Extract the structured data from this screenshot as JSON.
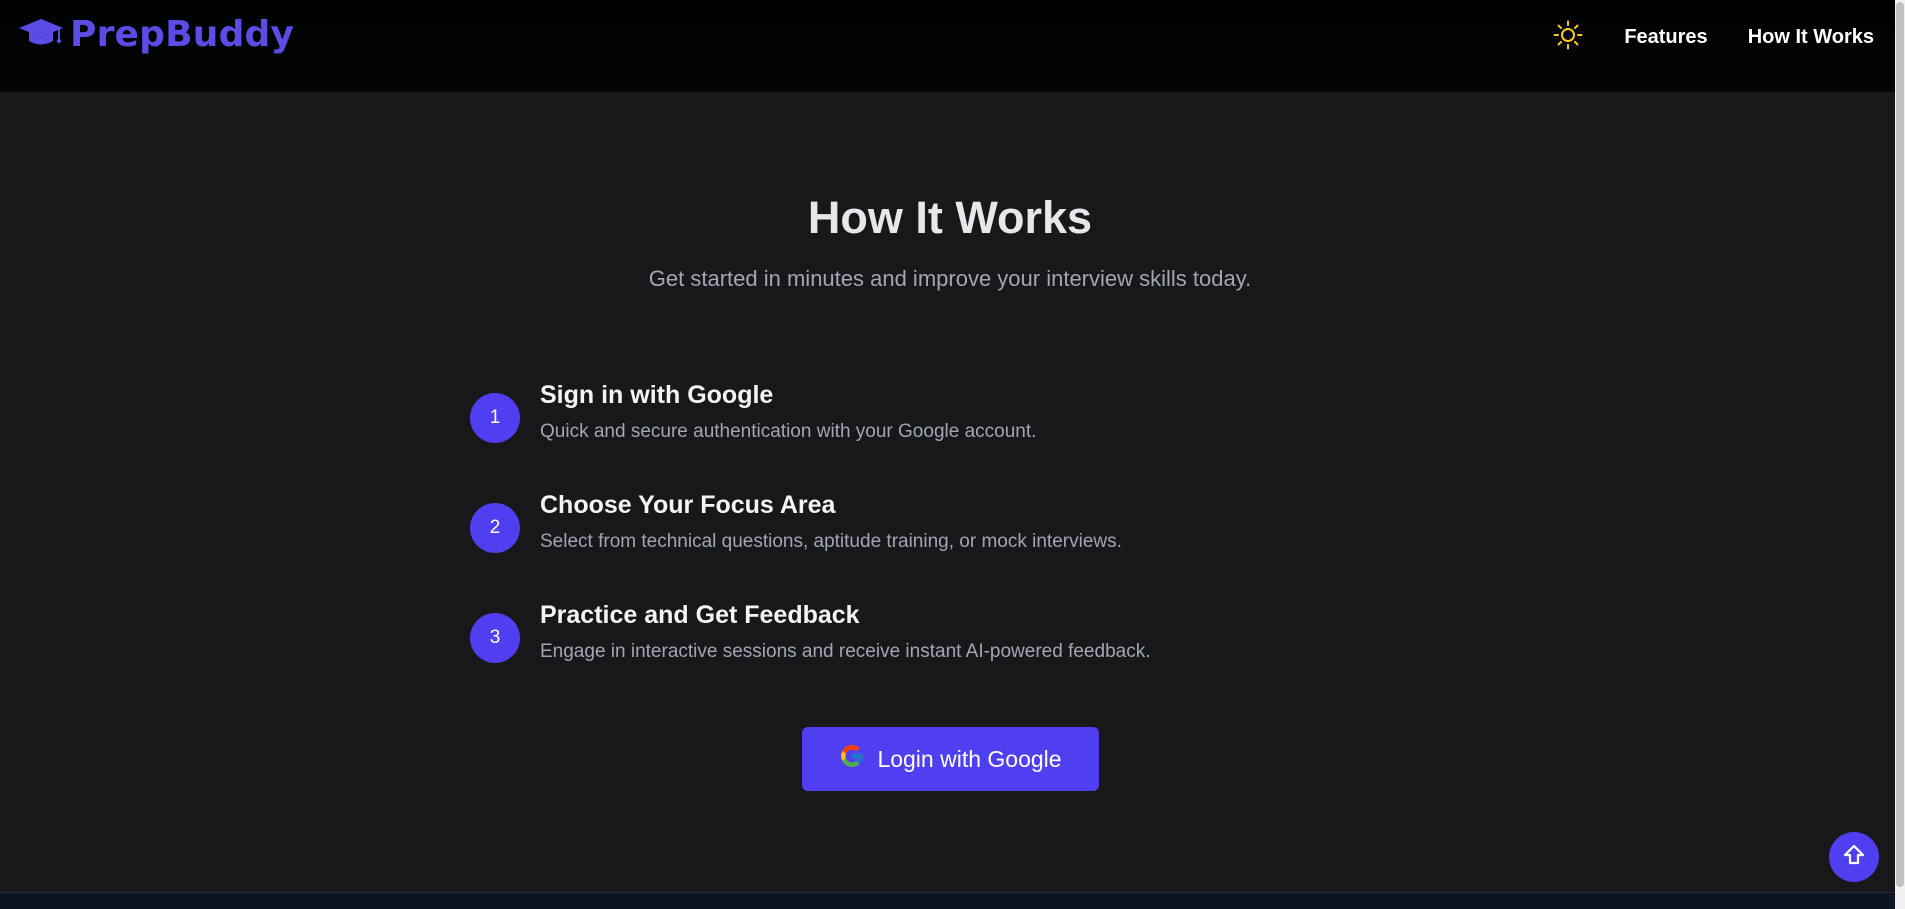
{
  "header": {
    "brand_name": "PrepBuddy",
    "logo_icon": "graduation-cap-icon",
    "theme_toggle_icon": "sun-icon",
    "nav": [
      {
        "label": "Features"
      },
      {
        "label": "How It Works"
      }
    ]
  },
  "main": {
    "title": "How It Works",
    "subtitle": "Get started in minutes and improve your interview skills today.",
    "steps": [
      {
        "number": "1",
        "title": "Sign in with Google",
        "description": "Quick and secure authentication with your Google account."
      },
      {
        "number": "2",
        "title": "Choose Your Focus Area",
        "description": "Select from technical questions, aptitude training, or mock interviews."
      },
      {
        "number": "3",
        "title": "Practice and Get Feedback",
        "description": "Engage in interactive sessions and receive instant AI-powered feedback."
      }
    ],
    "login_button": {
      "label": "Login with Google",
      "icon": "google-icon"
    }
  },
  "scroll_top_icon": "arrow-up-icon",
  "colors": {
    "accent": "#4f3ff0",
    "brand": "#5b4ce6",
    "background": "#18181b",
    "header_background": "#000000",
    "sun": "#facc15"
  }
}
